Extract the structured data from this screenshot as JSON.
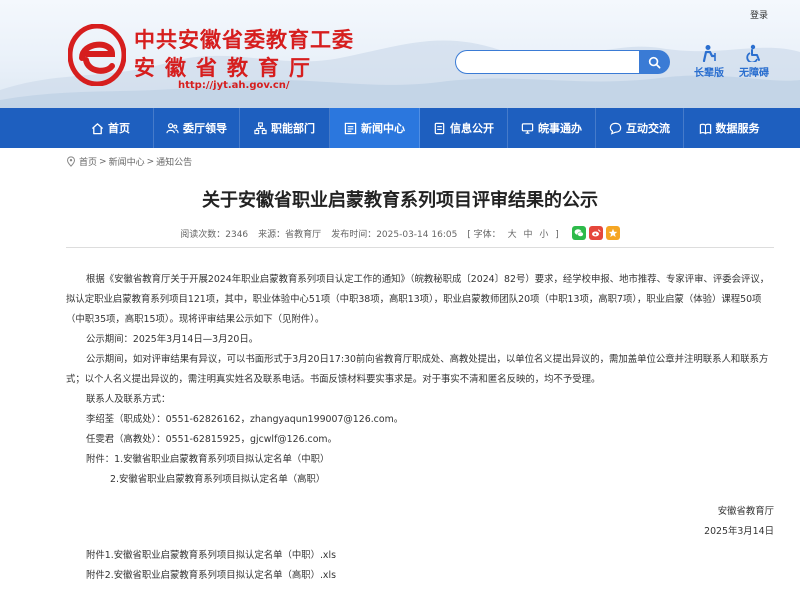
{
  "header": {
    "login": "登录",
    "logo_line1": "中共安徽省委教育工委",
    "logo_line2": "安徽省教育厅",
    "logo_url": "http://jyt.ah.gov.cn/",
    "search_placeholder": "",
    "tools": [
      {
        "label": "长辈版",
        "icon": "elder-icon"
      },
      {
        "label": "无障碍",
        "icon": "accessibility-icon"
      }
    ],
    "brand_color": "#d61e1e",
    "accent_color": "#2b6fcf"
  },
  "nav": {
    "items": [
      {
        "label": "首页",
        "icon": "home-icon"
      },
      {
        "label": "委厅领导",
        "icon": "leaders-icon"
      },
      {
        "label": "职能部门",
        "icon": "departments-icon"
      },
      {
        "label": "新闻中心",
        "icon": "news-icon",
        "active": true
      },
      {
        "label": "信息公开",
        "icon": "info-icon"
      },
      {
        "label": "皖事通办",
        "icon": "service-icon"
      },
      {
        "label": "互动交流",
        "icon": "chat-icon"
      },
      {
        "label": "数据服务",
        "icon": "data-icon"
      }
    ],
    "color": "#1e5fbf",
    "active_color": "#2b77de"
  },
  "breadcrumb": {
    "items": [
      "首页",
      "新闻中心",
      "通知公告"
    ],
    "separator": ">"
  },
  "article": {
    "title": "关于安徽省职业启蒙教育系列项目评审结果的公示",
    "meta": {
      "views_label": "阅读次数：",
      "views": "2346",
      "source_label": "来源：",
      "source": "省教育厅",
      "time_label": "发布时间：",
      "time": "2025-03-14 16:05",
      "font_label": "[ 字体：",
      "font_large": "大",
      "font_medium": "中",
      "font_small": "小",
      "font_close": "]"
    },
    "paragraphs": {
      "p1": "根据《安徽省教育厅关于开展2024年职业启蒙教育系列项目认定工作的通知》（皖教秘职成〔2024〕82号）要求，经学校申报、地市推荐、专家评审、评委会评议，拟认定职业启蒙教育系列项目121项，其中，职业体验中心51项（中职38项，高职13项），职业启蒙教师团队20项（中职13项，高职7项），职业启蒙（体验）课程50项（中职35项，高职15项）。现将评审结果公示如下（见附件）。",
      "p2": "公示期间：2025年3月14日—3月20日。",
      "p3": "公示期间，如对评审结果有异议，可以书面形式于3月20日17:30前向省教育厅职成处、高教处提出，以单位名义提出异议的，需加盖单位公章并注明联系人和联系方式；以个人名义提出异议的，需注明真实姓名及联系电话。书面反馈材料要实事求是。对于事实不清和匿名反映的，均不予受理。",
      "p4": "联系人及联系方式：",
      "p5": "李绍荃（职成处）：0551-62826162，zhangyaqun199007@126.com。",
      "p6": "任雯君（高教处）：0551-62815925，gjcwlf@126.com。",
      "p7": "附件：1.安徽省职业启蒙教育系列项目拟认定名单（中职）",
      "p8": "2.安徽省职业启蒙教育系列项目拟认定名单（高职）",
      "signature": "安徽省教育厅",
      "date": "2025年3月14日"
    },
    "attachments": [
      "附件1.安徽省职业启蒙教育系列项目拟认定名单（中职）.xls",
      "附件2.安徽省职业启蒙教育系列项目拟认定名单（高职）.xls"
    ]
  }
}
